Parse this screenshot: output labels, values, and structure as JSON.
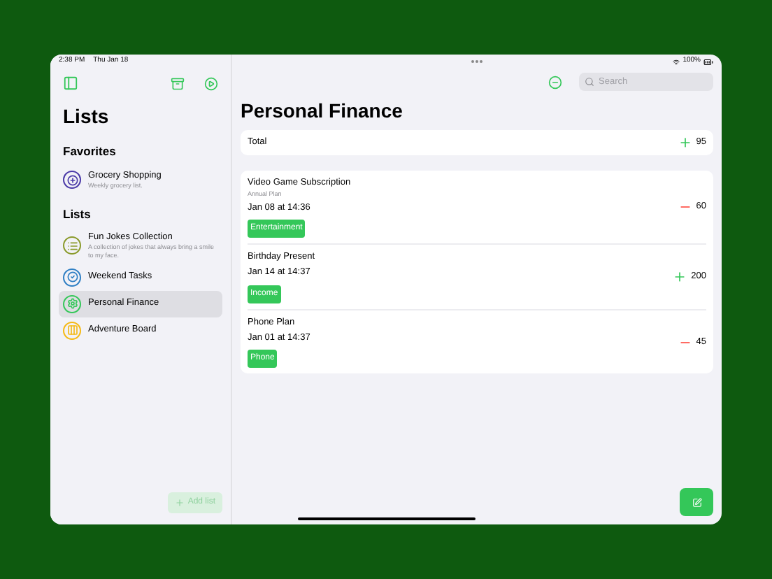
{
  "status_bar": {
    "time": "2:38 PM",
    "date": "Thu Jan 18",
    "battery": "100%"
  },
  "sidebar": {
    "title": "Lists",
    "sections": [
      {
        "title": "Favorites",
        "items": [
          {
            "name": "Grocery Shopping",
            "subtitle": "Weekly grocery list.",
            "kind": "plus-minus",
            "color": "#4b3aa8",
            "selected": false
          }
        ]
      },
      {
        "title": "Lists",
        "items": [
          {
            "name": "Fun Jokes Collection",
            "subtitle": "A collection of jokes that always bring a smile to my face.",
            "kind": "list",
            "color": "#8a9a2b",
            "selected": false
          },
          {
            "name": "Weekend Tasks",
            "kind": "check",
            "color": "#2f7fc4",
            "selected": false
          },
          {
            "name": "Personal Finance",
            "kind": "gear",
            "color": "#34c759",
            "selected": true
          },
          {
            "name": "Adventure Board",
            "kind": "columns",
            "color": "#f5b915",
            "selected": false
          }
        ]
      }
    ],
    "add_button": "Add list"
  },
  "main": {
    "title": "Personal Finance",
    "search": {
      "placeholder": "Search"
    },
    "total": {
      "label": "Total",
      "kind": "income",
      "amount": "95"
    },
    "transactions": [
      {
        "title": "Video Game Subscription",
        "note": "Annual Plan",
        "date": "Jan 08 at 14:36",
        "tag": "Entertainment",
        "kind": "expense",
        "amount": "60"
      },
      {
        "title": "Birthday Present",
        "date": "Jan 14 at 14:37",
        "tag": "Income",
        "kind": "income",
        "amount": "200"
      },
      {
        "title": "Phone Plan",
        "date": "Jan 01 at 14:37",
        "tag": "Phone",
        "kind": "expense",
        "amount": "45"
      }
    ]
  }
}
